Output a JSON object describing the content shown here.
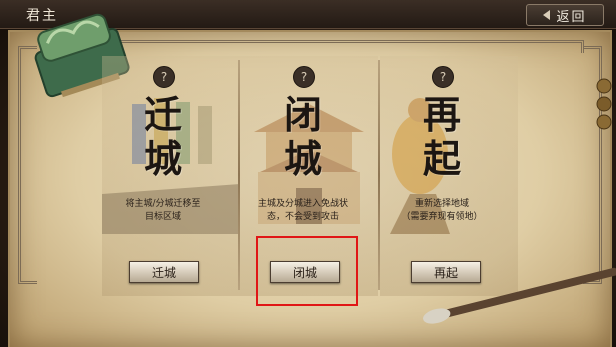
{
  "header": {
    "title": "君主",
    "back_label": "返回"
  },
  "options": [
    {
      "id": "relocate",
      "big_char_1": "迁",
      "big_char_2": "城",
      "help": "?",
      "desc_line1": "将主城/分城迁移至",
      "desc_line2": "目标区域",
      "button": "迁城"
    },
    {
      "id": "close",
      "big_char_1": "闭",
      "big_char_2": "城",
      "help": "?",
      "desc_line1": "主城及分城进入免战状",
      "desc_line2": "态，不会受到攻击",
      "button": "闭城"
    },
    {
      "id": "restart",
      "big_char_1": "再",
      "big_char_2": "起",
      "help": "?",
      "desc_line1": "重新选择地域",
      "desc_line2": "（需要弃现有领地）",
      "button": "再起"
    }
  ],
  "highlighted_option": "close",
  "colors": {
    "highlight": "#e01616",
    "paper": "#e6d7b2",
    "ink": "#1c1612"
  }
}
